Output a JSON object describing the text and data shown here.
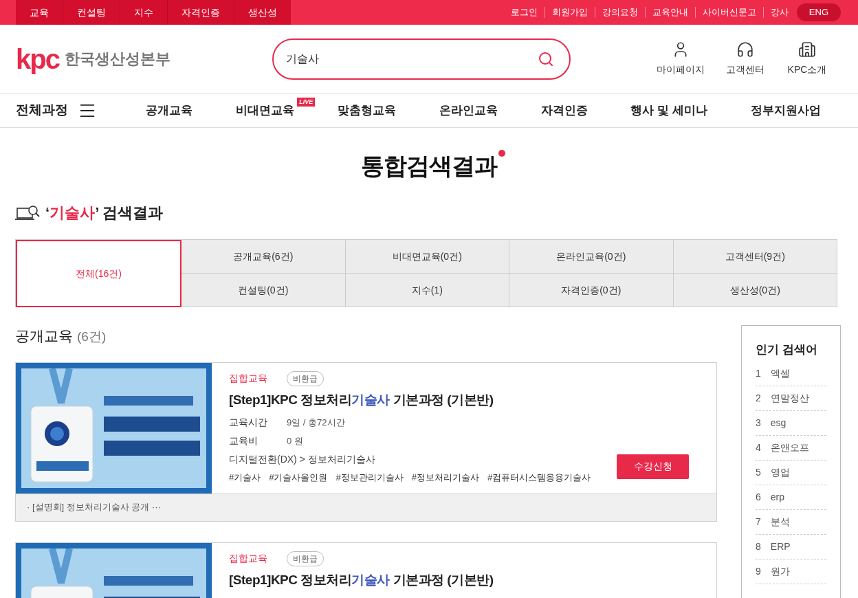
{
  "top_bar": {
    "menu": [
      "교육",
      "컨설팅",
      "지수",
      "자격인증",
      "생산성"
    ],
    "links": [
      "로그인",
      "회원가입",
      "강의요청",
      "교육안내",
      "사이버신문고",
      "강사"
    ],
    "lang_button": "ENG"
  },
  "header": {
    "logo_mark": "kpc",
    "logo_text": "한국생산성본부",
    "search": {
      "value": "기술사"
    },
    "shortcuts": [
      {
        "label": "마이페이지",
        "kind": "user"
      },
      {
        "label": "고객센터",
        "kind": "headset"
      },
      {
        "label": "KPC소개",
        "kind": "building"
      }
    ]
  },
  "nav": {
    "all_label": "전체과정",
    "items": [
      {
        "label": "공개교육"
      },
      {
        "label": "비대면교육",
        "badge": "LIVE"
      },
      {
        "label": "맞춤형교육"
      },
      {
        "label": "온라인교육"
      },
      {
        "label": "자격인증"
      },
      {
        "label": "행사 및 세미나"
      },
      {
        "label": "정부지원사업"
      }
    ]
  },
  "page_title": "통합검색결과",
  "result_heading": {
    "open_quote": "‘",
    "query": "기술사",
    "rest": "’ 검색결과"
  },
  "filter_tabs": [
    {
      "label": "전체(16건)",
      "selected": true
    },
    {
      "label": "공개교육(6건)",
      "selected": false
    },
    {
      "label": "비대면교육(0건)",
      "selected": false
    },
    {
      "label": "온라인교육(0건)",
      "selected": false
    },
    {
      "label": "고객센터(9건)",
      "selected": false
    },
    {
      "label": "컨설팅(0건)",
      "selected": false
    },
    {
      "label": "지수(1)",
      "selected": false
    },
    {
      "label": "자격인증(0건)",
      "selected": false
    },
    {
      "label": "생산성(0건)",
      "selected": false
    }
  ],
  "section": {
    "title": "공개교육",
    "count": "(6건)"
  },
  "courses": [
    {
      "category": "집합교육",
      "badge": "비환급",
      "title_before": "[Step1]KPC 정보처리",
      "title_highlight": "기술사",
      "title_after": " 기본과정 (기본반)",
      "info": [
        {
          "label": "교육시간",
          "value": "9일 / 총72시간"
        },
        {
          "label": "교육비",
          "value": "0 원"
        }
      ],
      "path": "디지털전환(DX) > 정보처리기술사",
      "tags": [
        "#기술사",
        "#기술사올인원",
        "#정보관리기술사",
        "#정보처리기술사",
        "#컴퓨터시스템응용기술사"
      ],
      "apply_button": "수강신청",
      "note": "· [설명회] 정보처리기술사 공개 ···"
    },
    {
      "category": "집합교육",
      "badge": "비환급",
      "title_before": "[Step1]KPC 정보처리",
      "title_highlight": "기술사",
      "title_after": " 기본과정 (기본반)"
    }
  ],
  "popular": {
    "title": "인기 검색어",
    "items": [
      {
        "rank": "1",
        "term": "엑셀"
      },
      {
        "rank": "2",
        "term": "연말정산"
      },
      {
        "rank": "3",
        "term": "esg"
      },
      {
        "rank": "4",
        "term": "온앤오프"
      },
      {
        "rank": "5",
        "term": "영업"
      },
      {
        "rank": "6",
        "term": "erp"
      },
      {
        "rank": "7",
        "term": "분석"
      },
      {
        "rank": "8",
        "term": "ERP"
      },
      {
        "rank": "9",
        "term": "원가"
      }
    ]
  }
}
